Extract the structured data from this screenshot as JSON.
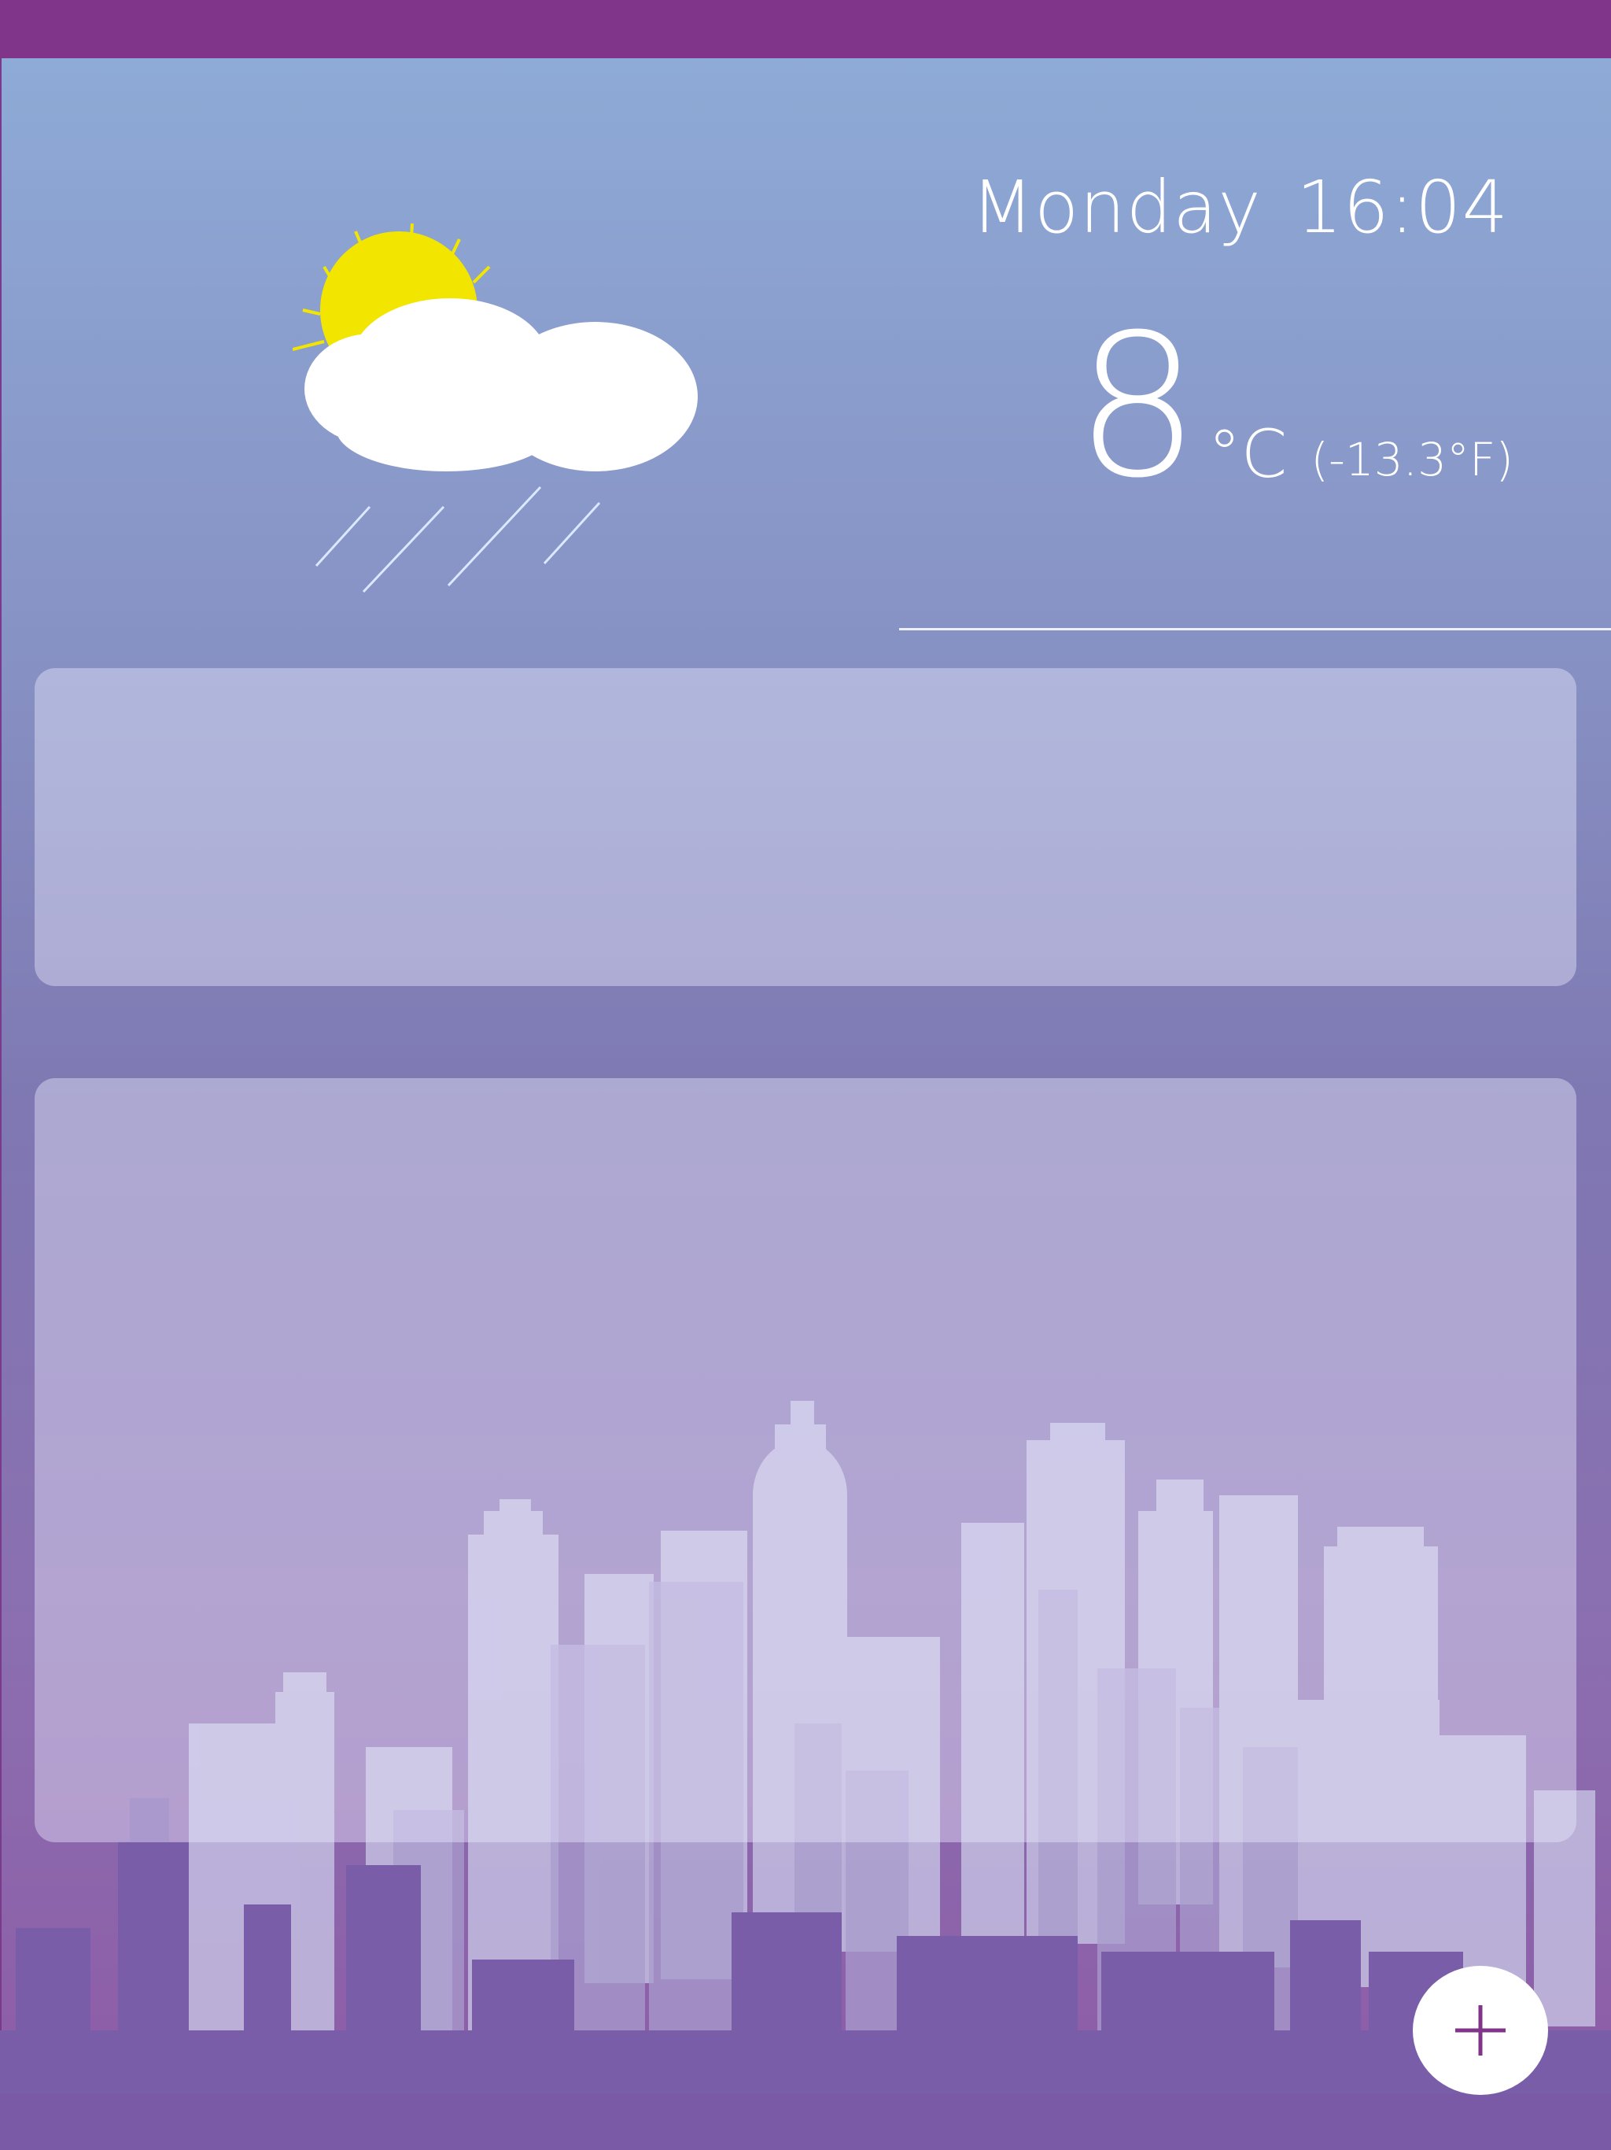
{
  "header": {
    "day": "Monday",
    "time": "16:04"
  },
  "weather": {
    "condition_icon": "sun-cloud-rain-icon",
    "temperature": "8",
    "unit": "°C",
    "fahrenheit": "(-13.3°F)"
  },
  "cards": [
    {
      "name": "summary-card"
    },
    {
      "name": "forecast-card"
    }
  ],
  "fab": {
    "icon": "plus-icon"
  },
  "colors": {
    "topbar": "#80348a",
    "sky_top": "#8eaad6",
    "sky_bottom": "#8e5aa6",
    "sun": "#f2e600",
    "fab_icon": "#80348a"
  }
}
